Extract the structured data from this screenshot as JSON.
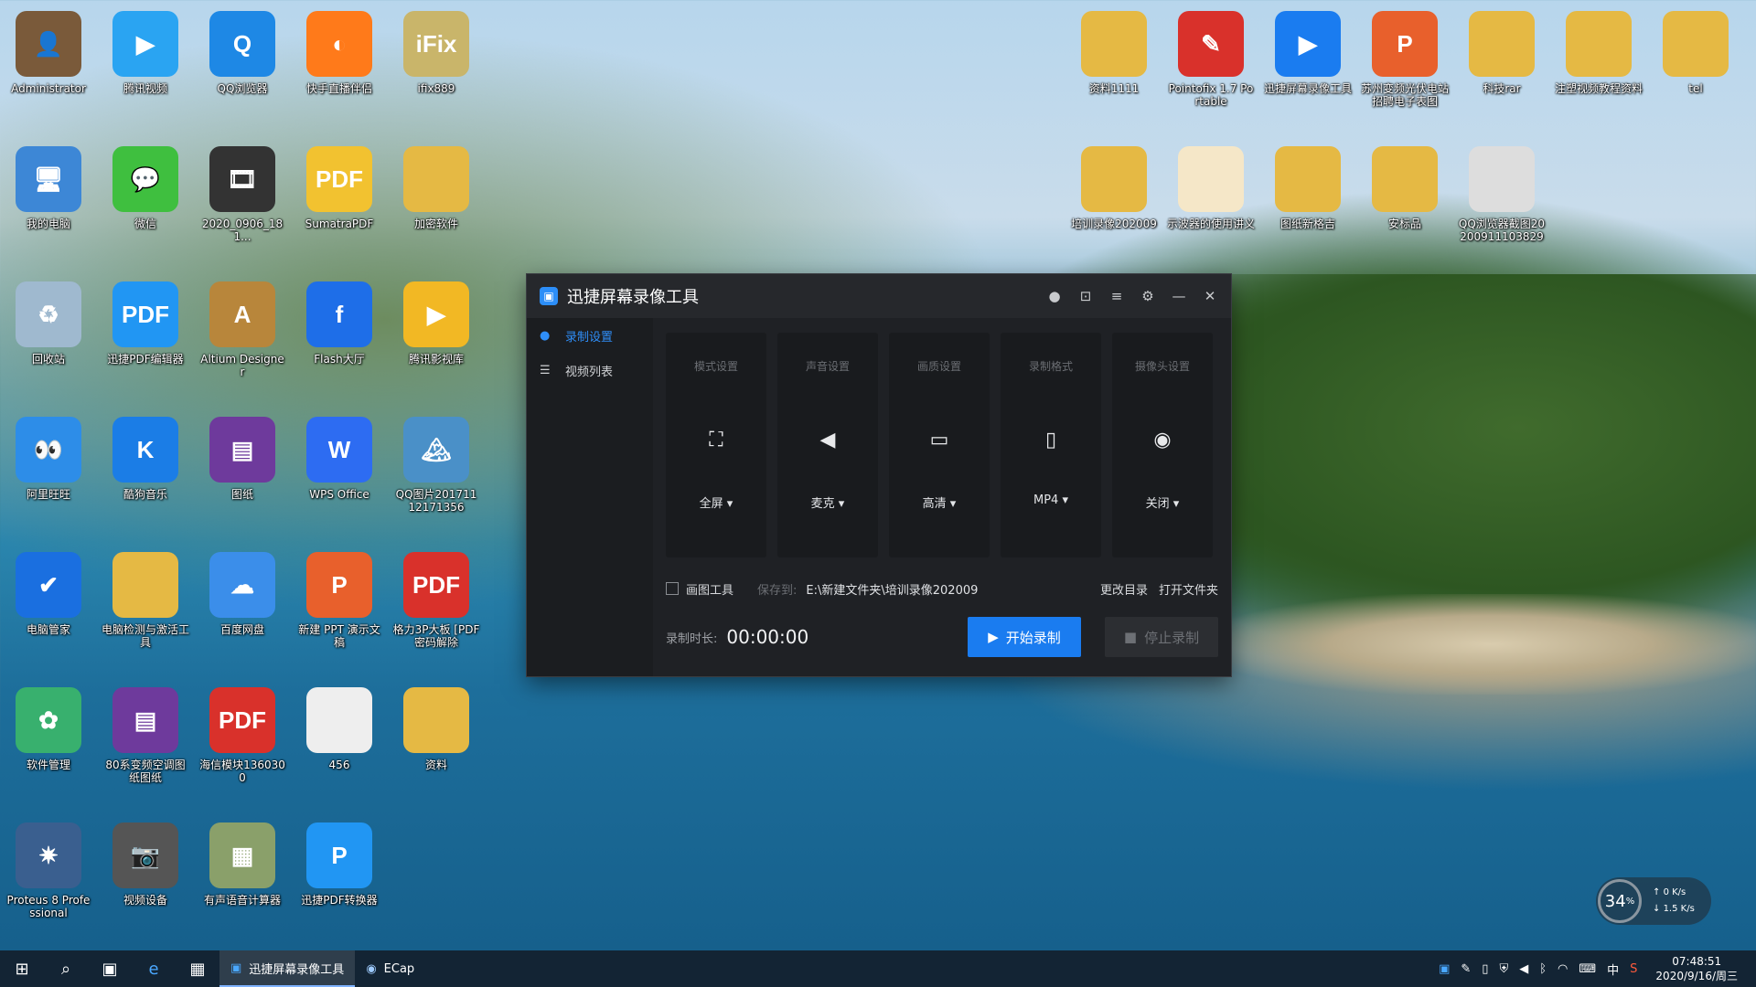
{
  "desktop": {
    "icons": [
      {
        "label": "Administrator",
        "glyph": "👤",
        "color": "#7a5a3a"
      },
      {
        "label": "腾讯视频",
        "glyph": "▶",
        "color": "#2aa4f2"
      },
      {
        "label": "QQ浏览器",
        "glyph": "Q",
        "color": "#1e88e5"
      },
      {
        "label": "快手直播伴侣",
        "glyph": "◐",
        "color": "#ff7a1a"
      },
      {
        "label": "ifix889",
        "glyph": "iFix",
        "color": "#c9b56a"
      },
      {
        "label": "我的电脑",
        "glyph": "🖥",
        "color": "#3d87d6"
      },
      {
        "label": "微信",
        "glyph": "💬",
        "color": "#3fbf3f"
      },
      {
        "label": "2020_0906_181...",
        "glyph": "🎞",
        "color": "#333333"
      },
      {
        "label": "SumatraPDF",
        "glyph": "PDF",
        "color": "#f2c230"
      },
      {
        "label": "加密软件",
        "glyph": "",
        "color": "#e5b944"
      },
      {
        "label": "回收站",
        "glyph": "♻",
        "color": "#9fb9cf"
      },
      {
        "label": "迅捷PDF编辑器",
        "glyph": "PDF",
        "color": "#2196f3"
      },
      {
        "label": "Altium Designer",
        "glyph": "A",
        "color": "#b8863b"
      },
      {
        "label": "Flash大厅",
        "glyph": "f",
        "color": "#1e6ee8"
      },
      {
        "label": "腾讯影视库",
        "glyph": "▶",
        "color": "#f2b824"
      },
      {
        "label": "阿里旺旺",
        "glyph": "👀",
        "color": "#2d8de8"
      },
      {
        "label": "酷狗音乐",
        "glyph": "K",
        "color": "#1b7de6"
      },
      {
        "label": "图纸",
        "glyph": "▤",
        "color": "#6e3a9c"
      },
      {
        "label": "WPS Office",
        "glyph": "W",
        "color": "#2d6cf2"
      },
      {
        "label": "QQ图片20171112171356",
        "glyph": "🏔",
        "color": "#4a90c8"
      },
      {
        "label": "电脑管家",
        "glyph": "✔",
        "color": "#1a6fe0"
      },
      {
        "label": "电脑检测与激活工具",
        "glyph": "",
        "color": "#e5b944"
      },
      {
        "label": "百度网盘",
        "glyph": "☁",
        "color": "#3b8eea"
      },
      {
        "label": "新建 PPT 演示文稿",
        "glyph": "P",
        "color": "#e8602c"
      },
      {
        "label": "格力3P大板 [PDF密码解除",
        "glyph": "PDF",
        "color": "#d9312b"
      },
      {
        "label": "软件管理",
        "glyph": "✿",
        "color": "#38b06e"
      },
      {
        "label": "80系变频空调图纸图纸",
        "glyph": "▤",
        "color": "#6e3a9c"
      },
      {
        "label": "海信模块1360300",
        "glyph": "PDF",
        "color": "#d9312b"
      },
      {
        "label": "456",
        "glyph": "",
        "color": "#eeeeee"
      },
      {
        "label": "资料",
        "glyph": "",
        "color": "#e5b944"
      },
      {
        "label": "Proteus 8 Professional",
        "glyph": "✷",
        "color": "#3a5f8f"
      },
      {
        "label": "视频设备",
        "glyph": "📷",
        "color": "#555555"
      },
      {
        "label": "有声语音计算器",
        "glyph": "▦",
        "color": "#8aa06a"
      },
      {
        "label": "迅捷PDF转换器",
        "glyph": "P",
        "color": "#2196f3"
      }
    ],
    "right_icons": [
      {
        "label": "资料1111",
        "glyph": "",
        "color": "#e5b944"
      },
      {
        "label": "Pointofix 1.7 Portable",
        "glyph": "✎",
        "color": "#d9312b"
      },
      {
        "label": "迅捷屏幕录像工具",
        "glyph": "▶",
        "color": "#1a7cf0"
      },
      {
        "label": "苏州变频光伏电站招聘电子表图",
        "glyph": "P",
        "color": "#e8602c"
      },
      {
        "label": "科技rar",
        "glyph": "",
        "color": "#e5b944"
      },
      {
        "label": "注塑视频教程资料",
        "glyph": "",
        "color": "#e5b944"
      },
      {
        "label": "tel",
        "glyph": "",
        "color": "#e5b944"
      },
      {
        "label": "培训录像202009",
        "glyph": "",
        "color": "#e5b944"
      },
      {
        "label": "示波器的使用讲义",
        "glyph": "",
        "color": "#f5e7c8"
      },
      {
        "label": "图纸新格吉",
        "glyph": "",
        "color": "#e5b944"
      },
      {
        "label": "安标品",
        "glyph": "",
        "color": "#e5b944"
      },
      {
        "label": "QQ浏览器截图20200911103829",
        "glyph": "",
        "color": "#dddddd"
      }
    ]
  },
  "app": {
    "title": "迅捷屏幕录像工具",
    "logo_glyph": "▣",
    "title_icons": [
      "user-icon",
      "cart-icon",
      "menu-icon",
      "settings-icon",
      "minimize-icon",
      "close-icon"
    ],
    "title_glyphs": [
      "●",
      "⊡",
      "≡",
      "⚙",
      "—",
      "✕"
    ],
    "sidebar": [
      {
        "label": "录制设置",
        "glyph": "●",
        "active": true
      },
      {
        "label": "视频列表",
        "glyph": "☰",
        "active": false
      }
    ],
    "cards": [
      {
        "title": "模式设置",
        "glyph": "⛶",
        "value": "全屏 ▾"
      },
      {
        "title": "声音设置",
        "glyph": "◀",
        "value": "麦克 ▾"
      },
      {
        "title": "画质设置",
        "glyph": "▭",
        "value": "高清 ▾"
      },
      {
        "title": "录制格式",
        "glyph": "▯",
        "value": "MP4 ▾"
      },
      {
        "title": "摄像头设置",
        "glyph": "◉",
        "value": "关闭 ▾"
      }
    ],
    "draw_tool_label": "画图工具",
    "save_to_label": "保存到:",
    "save_path": "E:\\新建文件夹\\培训录像202009",
    "change_dir": "更改目录",
    "open_folder": "打开文件夹",
    "duration_label": "录制时长:",
    "duration_value": "00:00:00",
    "start_button": "开始录制",
    "stop_button": "停止录制"
  },
  "taskbar": {
    "apps": [
      {
        "label": "迅捷屏幕录像工具",
        "active": true
      },
      {
        "label": "ECap",
        "active": false
      }
    ],
    "time": "07:48:51",
    "date": "2020/9/16/周三",
    "ime": "中"
  },
  "widget": {
    "percent": "34",
    "up": "0",
    "down": "1.5"
  }
}
